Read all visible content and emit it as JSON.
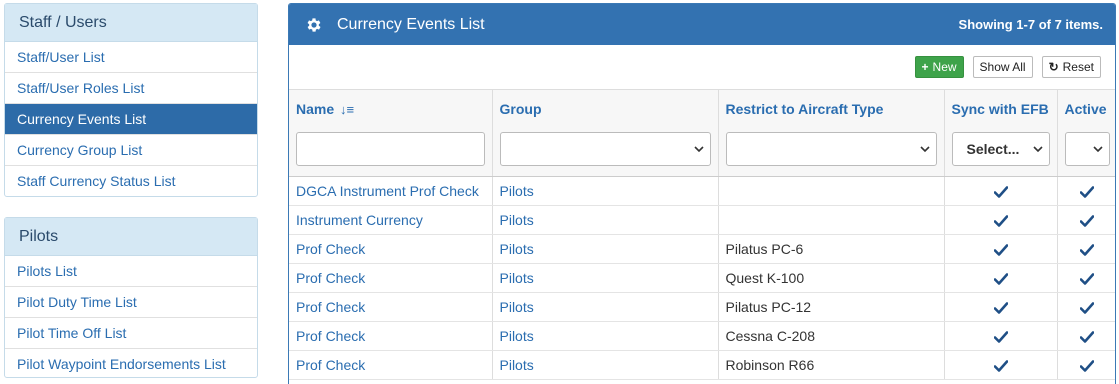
{
  "sidebar": {
    "staff": {
      "title": "Staff / Users",
      "items": [
        {
          "label": "Staff/User List"
        },
        {
          "label": "Staff/User Roles List"
        },
        {
          "label": "Currency Events List"
        },
        {
          "label": "Currency Group List"
        },
        {
          "label": "Staff Currency Status List"
        }
      ]
    },
    "pilots": {
      "title": "Pilots",
      "items": [
        {
          "label": "Pilots List"
        },
        {
          "label": "Pilot Duty Time List"
        },
        {
          "label": "Pilot Time Off List"
        },
        {
          "label": "Pilot Waypoint Endorsements List"
        }
      ]
    }
  },
  "main": {
    "title": "Currency Events List",
    "summary": "Showing 1-7 of 7 items.",
    "toolbar": {
      "new_label": "New",
      "show_all_label": "Show All",
      "reset_label": "Reset"
    },
    "columns": {
      "name": "Name",
      "group": "Group",
      "aircraft": "Restrict to Aircraft Type",
      "sync": "Sync with EFB",
      "active": "Active"
    },
    "filters": {
      "sync_selected": "Select..."
    },
    "rows": [
      {
        "name": "DGCA Instrument Prof Check",
        "group": "Pilots",
        "aircraft": "",
        "sync": true,
        "active": true
      },
      {
        "name": "Instrument Currency",
        "group": "Pilots",
        "aircraft": "",
        "sync": true,
        "active": true
      },
      {
        "name": "Prof Check",
        "group": "Pilots",
        "aircraft": "Pilatus PC-6",
        "sync": true,
        "active": true
      },
      {
        "name": "Prof Check",
        "group": "Pilots",
        "aircraft": "Quest K-100",
        "sync": true,
        "active": true
      },
      {
        "name": "Prof Check",
        "group": "Pilots",
        "aircraft": "Pilatus PC-12",
        "sync": true,
        "active": true
      },
      {
        "name": "Prof Check",
        "group": "Pilots",
        "aircraft": "Cessna C-208",
        "sync": true,
        "active": true
      },
      {
        "name": "Prof Check",
        "group": "Pilots",
        "aircraft": "Robinson R66",
        "sync": true,
        "active": true
      }
    ]
  },
  "colors": {
    "header_blue": "#3372b1",
    "active_item": "#2d6ba8",
    "link": "#2a6db0",
    "new_green": "#3ea34a"
  },
  "icons": {
    "header": "gear-icon",
    "sort": "sort-numeric-down-icon",
    "new": "plus-icon",
    "reset": "refresh-icon",
    "check": "check-icon"
  }
}
